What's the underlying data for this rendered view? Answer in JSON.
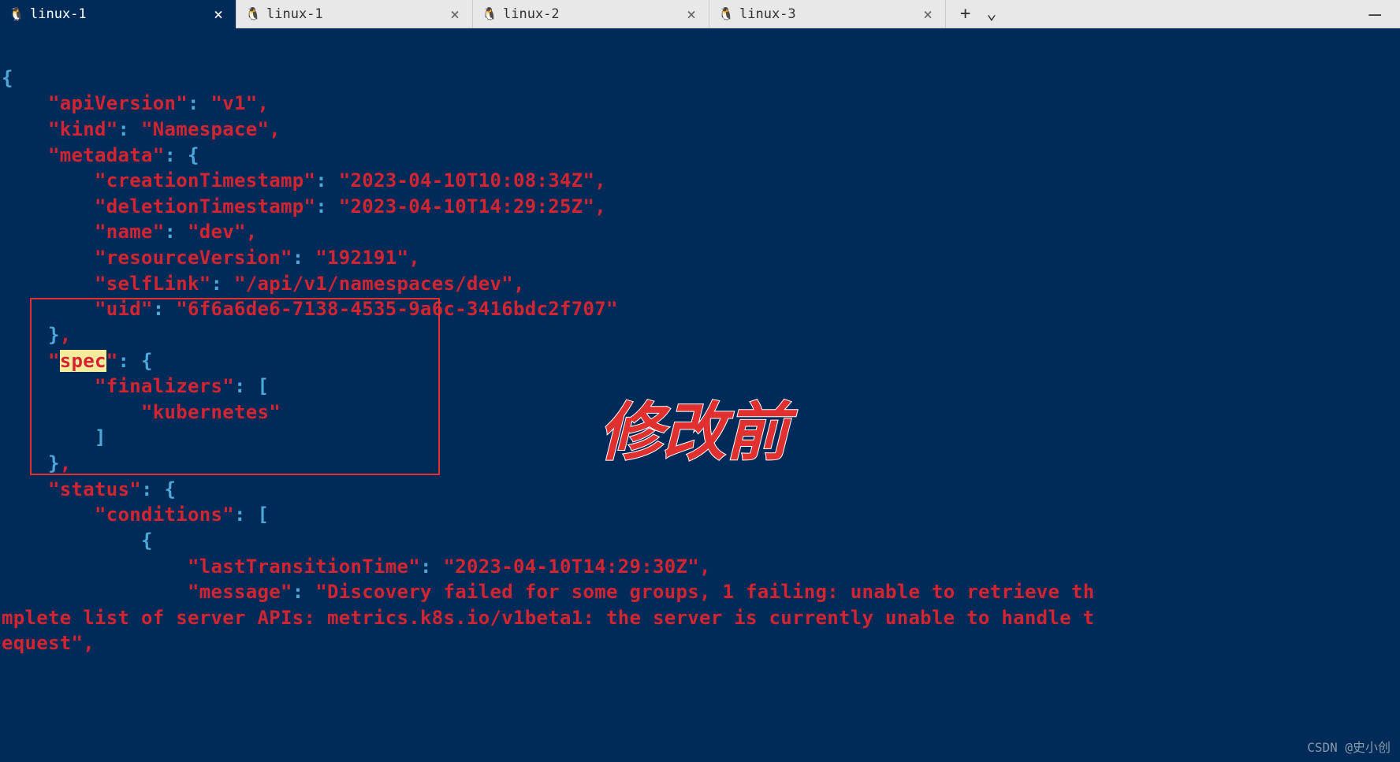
{
  "tabs": [
    {
      "label": "linux-1",
      "active": true
    },
    {
      "label": "linux-1",
      "active": false
    },
    {
      "label": "linux-2",
      "active": false
    },
    {
      "label": "linux-3",
      "active": false
    }
  ],
  "code": {
    "apiVersion_key": "\"apiVersion\"",
    "apiVersion_val": "\"v1\"",
    "kind_key": "\"kind\"",
    "kind_val": "\"Namespace\"",
    "metadata_key": "\"metadata\"",
    "creationTimestamp_key": "\"creationTimestamp\"",
    "creationTimestamp_val": "\"2023-04-10T10:08:34Z\"",
    "deletionTimestamp_key": "\"deletionTimestamp\"",
    "deletionTimestamp_val": "\"2023-04-10T14:29:25Z\"",
    "name_key": "\"name\"",
    "name_val": "\"dev\"",
    "resourceVersion_key": "\"resourceVersion\"",
    "resourceVersion_val": "\"192191\"",
    "selfLink_key": "\"selfLink\"",
    "selfLink_val": "\"/api/v1/namespaces/dev\"",
    "uid_key": "\"uid\"",
    "uid_val": "\"6f6a6de6-7138-4535-9a6c-3416bdc2f707\"",
    "spec_key_quote_open": "\"",
    "spec_key_text": "spec",
    "spec_key_quote_close": "\"",
    "finalizers_key": "\"finalizers\"",
    "finalizers_val": "\"kubernetes\"",
    "status_key": "\"status\"",
    "conditions_key": "\"conditions\"",
    "lastTransitionTime_key": "\"lastTransitionTime\"",
    "lastTransitionTime_val": "\"2023-04-10T14:29:30Z\"",
    "message_key": "\"message\"",
    "message_val_line1": "\"Discovery failed for some groups, 1 failing: unable to retrieve th",
    "message_val_line2": "mplete list of server APIs: metrics.k8s.io/v1beta1: the server is currently unable to handle t",
    "message_val_line3": "equest\""
  },
  "annotation": "修改前",
  "watermark": "CSDN @史小创"
}
